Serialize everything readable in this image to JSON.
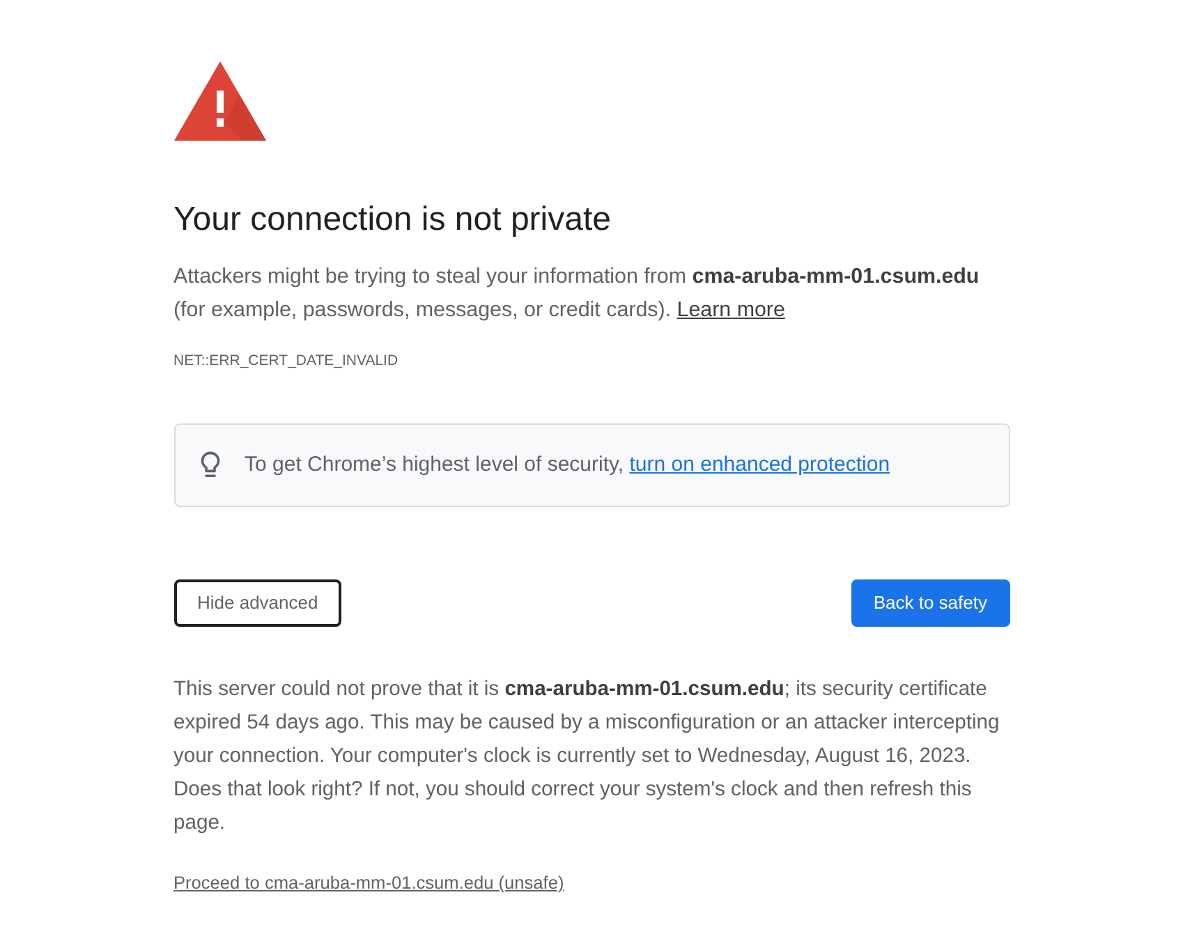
{
  "heading": "Your connection is not private",
  "explanation": {
    "text": "Attackers might be trying to steal your information from **cma-aruba-mm-01.csum.edu** (for example, passwords, messages, or credit cards).",
    "link": "Learn more"
  },
  "error_code": "NET::ERR_CERT_DATE_INVALID",
  "promo": {
    "text": "To get Chrome’s highest level of security,",
    "link": "turn on enhanced protection"
  },
  "buttons": [
    {
      "label": "Hide advanced",
      "kind": "secondary"
    },
    {
      "label": "Back to safety",
      "kind": "primary"
    }
  ],
  "details": "This server could not prove that it is **cma-aruba-mm-01.csum.edu**; its security certificate expired 54 days ago. This may be caused by a misconfiguration or an attacker intercepting your connection. Your computer's clock is currently set to Wednesday, August 16, 2023. Does that look right? If not, you should correct your system's clock and then refresh this page.",
  "proceed_link": "Proceed to cma-aruba-mm-01.csum.edu (unsafe)"
}
